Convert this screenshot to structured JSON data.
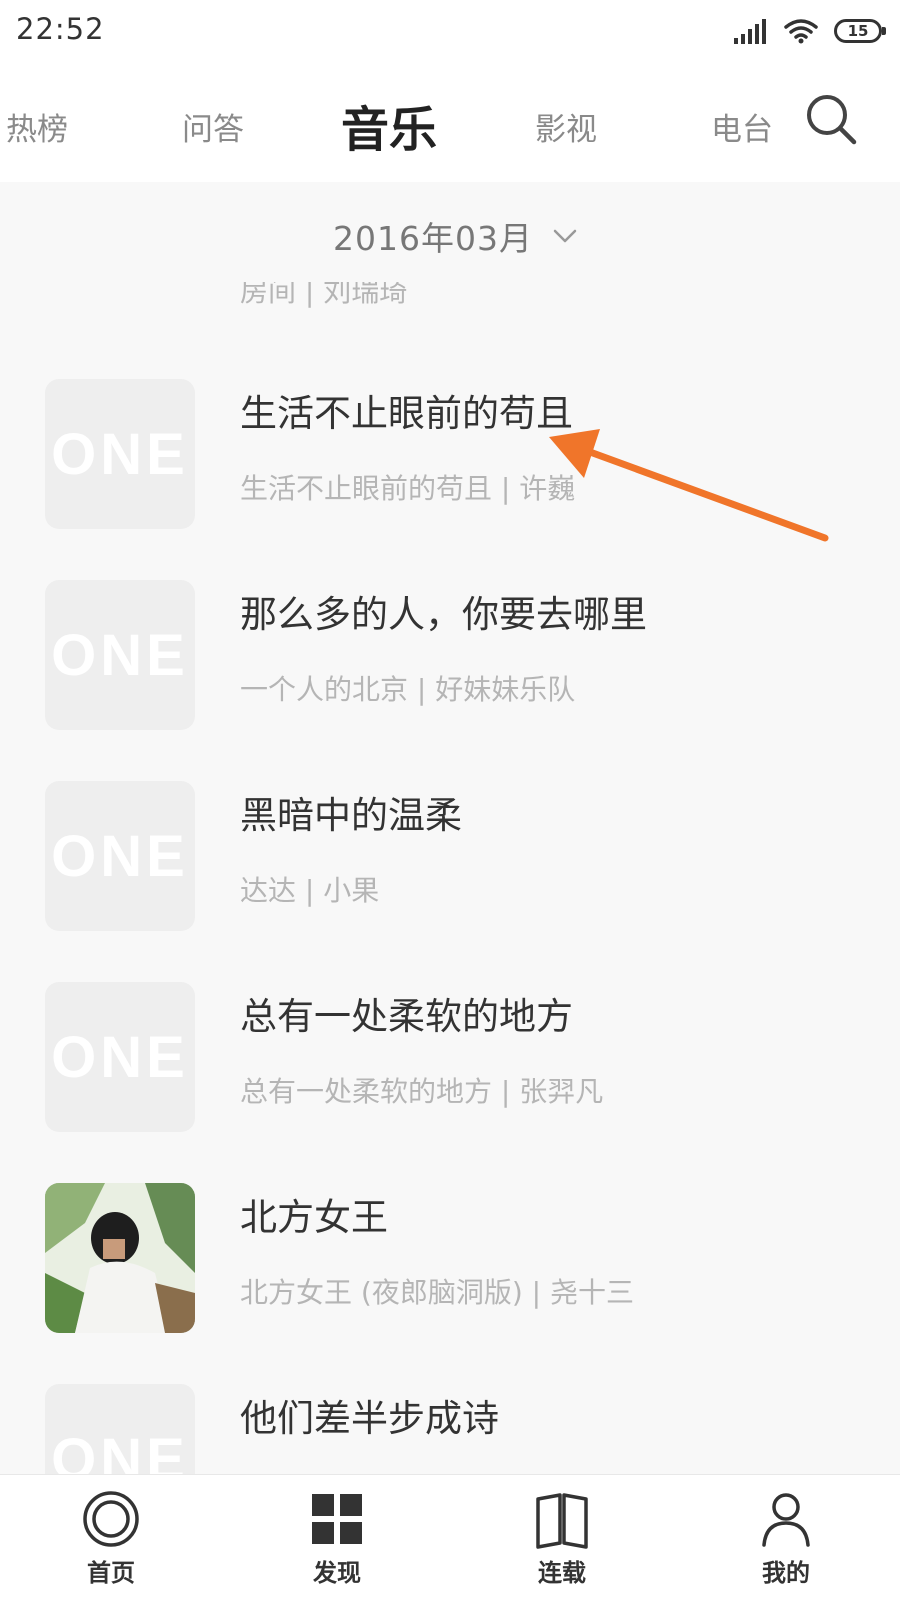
{
  "status_bar": {
    "time": "22:52",
    "battery": "15"
  },
  "tabs": [
    {
      "label": "热榜"
    },
    {
      "label": "问答"
    },
    {
      "label": "音乐",
      "active": true
    },
    {
      "label": "影视"
    },
    {
      "label": "电台"
    }
  ],
  "date_selector": {
    "label": "2016年03月"
  },
  "thumb_logo": "ONE",
  "list": {
    "partial_top_subtitle": "房间 | 刘瑞琦",
    "items": [
      {
        "title": "生活不止眼前的苟且",
        "subtitle": "生活不止眼前的苟且 | 许巍"
      },
      {
        "title": "那么多的人，你要去哪里",
        "subtitle": "一个人的北京 | 好妹妹乐队"
      },
      {
        "title": "黑暗中的温柔",
        "subtitle": "达达 | 小果"
      },
      {
        "title": "总有一处柔软的地方",
        "subtitle": "总有一处柔软的地方 | 张羿凡"
      },
      {
        "title": "北方女王",
        "subtitle": "北方女王 (夜郎脑洞版) | 尧十三"
      },
      {
        "title": "他们差半步成诗",
        "subtitle": ""
      }
    ]
  },
  "bottom_nav": [
    {
      "label": "首页"
    },
    {
      "label": "发现"
    },
    {
      "label": "连载"
    },
    {
      "label": "我的"
    }
  ],
  "colors": {
    "annotation_arrow": "#f0752a",
    "active_text": "#222222",
    "inactive_text": "#8a8a8a",
    "subtitle_text": "#b5b5b5"
  }
}
